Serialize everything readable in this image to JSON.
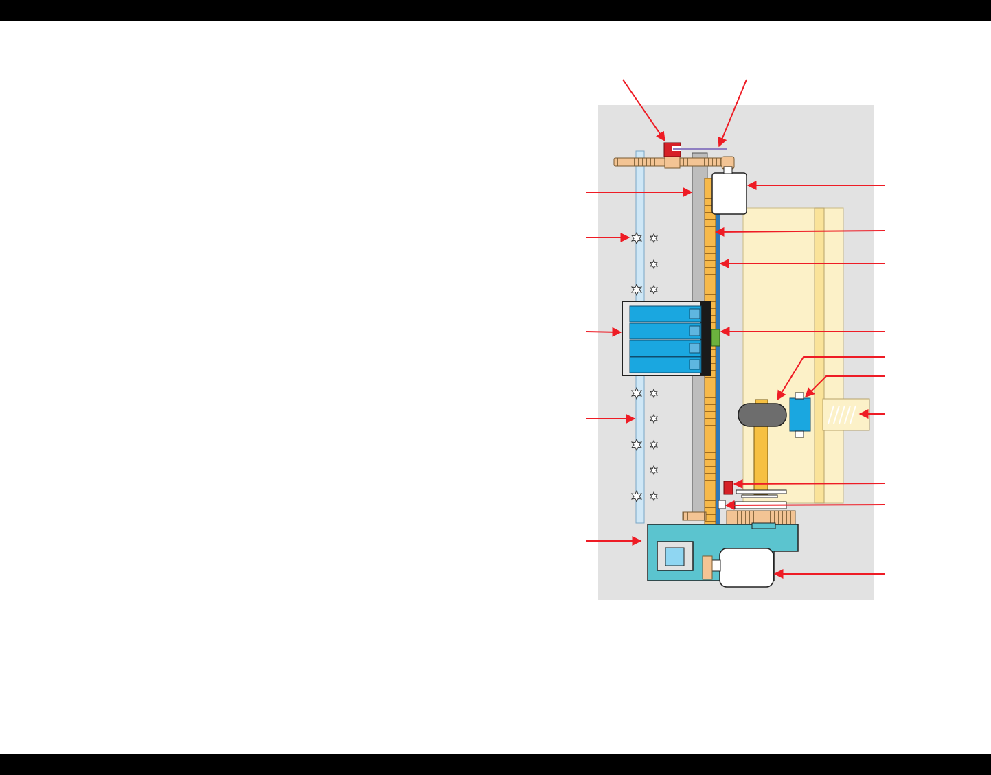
{
  "colors": {
    "page_background": "#ffffff",
    "bars": "#000000",
    "panel": "#e2e2e2",
    "callout_arrow": "#ee1c25",
    "cartridge_blue": "#1aa7e0",
    "carriage_base": "#5bc4cf",
    "paper": "#fcf1c8",
    "timing_belt": "#f6b94a",
    "gear": "#f3c494",
    "shaft_gray": "#bdbdbd",
    "encoder_blue": "#2f78b7",
    "sensor_red": "#d62027",
    "sensor_green": "#6cb23e",
    "cap_gray": "#6d6d6d"
  },
  "diagram": {
    "type": "mechanism-layout",
    "callout_count": 18,
    "labels_shown": false
  }
}
